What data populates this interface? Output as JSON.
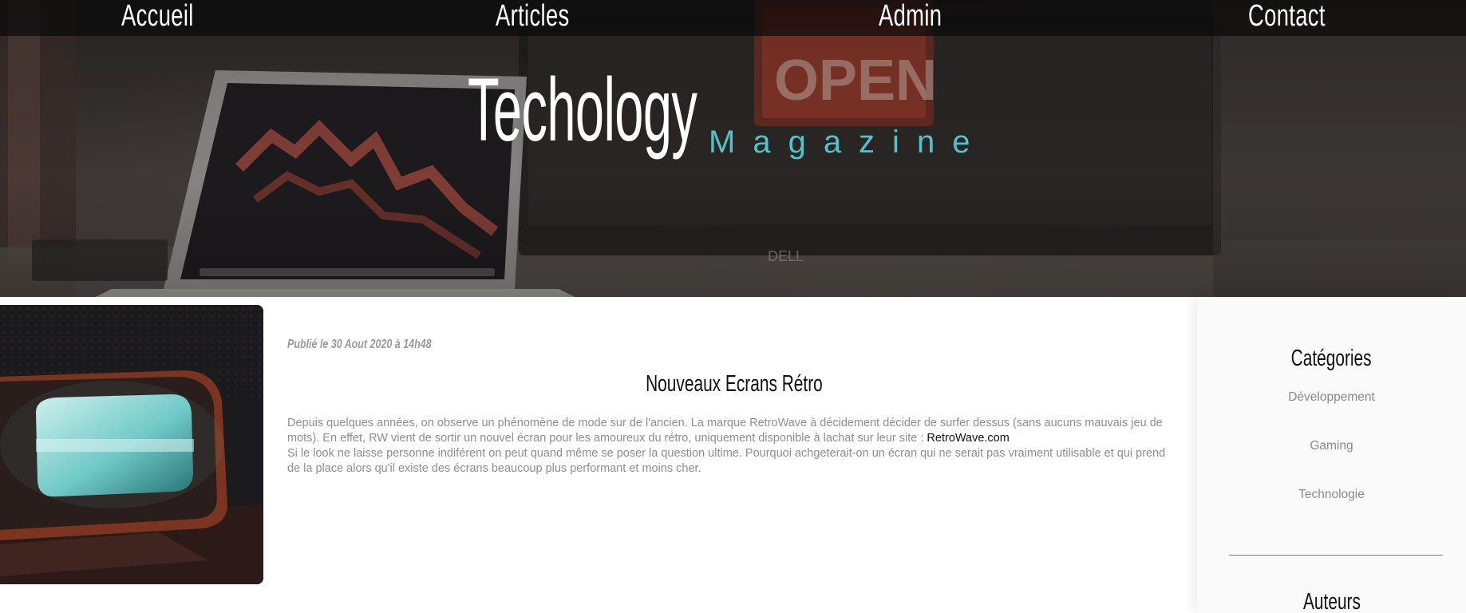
{
  "nav": {
    "items": [
      {
        "label": "Accueil"
      },
      {
        "label": "Articles"
      },
      {
        "label": "Admin"
      },
      {
        "label": "Contact"
      }
    ]
  },
  "brand": {
    "title": "Techology",
    "subtitle": "Magazine",
    "subtitle_color": "#52c3c9"
  },
  "article": {
    "date": "Publié le 30 Aout 2020 à 14h48",
    "title": "Nouveaux Ecrans Rétro",
    "body_before_link": "Depuis quelques années, on observe un phénomène de mode sur de l'ancien. La marque RetroWave à décidement décider de surfer dessus (sans aucuns mauvais jeu de mots). En effet, RW vient de sortir un nouvel écran pour les amoureux du rétro, uniquement disponible à lachat sur leur site : ",
    "link_text": "RetroWave.com",
    "body_after_link": "Si le look ne laisse personne indiférent on peut quand même se poser la question ultime. Pourquoi achgeterait-on un écran qui ne serait pas vraiment utilisable et qui prend de la place alors qu'il existe des écrans beaucoup plus performant et moins cher.",
    "image_icon": "retro-tv-image"
  },
  "sidebar": {
    "categories_title": "Catégories",
    "categories": [
      {
        "label": "Développement"
      },
      {
        "label": "Gaming"
      },
      {
        "label": "Technologie"
      }
    ],
    "authors_title": "Auteurs"
  },
  "colors": {
    "accent": "#52c3c9",
    "nav_bg": "#0a0a0a",
    "sidebar_bg": "#fafafa"
  }
}
